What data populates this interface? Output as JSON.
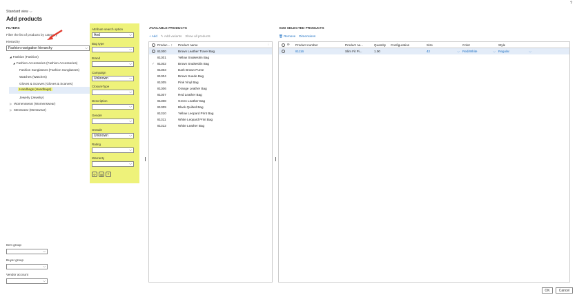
{
  "header": {
    "help_icon": "?",
    "view_name": "Standard view",
    "title": "Add products"
  },
  "filters": {
    "heading": "FILTERS",
    "hint": "Filter the list of products by category",
    "hierarchy_label": "Hierarchy",
    "hierarchy_value": "Fashion navigation hierarchy",
    "tree": [
      {
        "label": "Fashion (Fashion)",
        "toggle": "◢"
      },
      {
        "label": "Fashion Accessories (Fashion Accessories)",
        "toggle": "◢"
      },
      {
        "label": "Fashion Sunglasses (Fashion Sunglasses)",
        "toggle": ""
      },
      {
        "label": "Watches (Watches)",
        "toggle": ""
      },
      {
        "label": "Gloves & Scarves (Gloves & Scarves)",
        "toggle": ""
      },
      {
        "label": "Handbags (Handbags)",
        "toggle": "",
        "selected": true
      },
      {
        "label": "Jewelry (Jewelry)",
        "toggle": ""
      },
      {
        "label": "Womenswear (Womenswear)",
        "toggle": "▷"
      },
      {
        "label": "Menswear (Menswear)",
        "toggle": "▷"
      }
    ],
    "item_group_label": "Item group",
    "buyer_group_label": "Buyer group",
    "vendor_account_label": "Vendor account"
  },
  "attributes": {
    "search_option_label": "Attribute search option",
    "search_option_value": "And",
    "fields": [
      {
        "label": "Bag type",
        "value": ""
      },
      {
        "label": "Brand",
        "value": ""
      },
      {
        "label": "Campaign",
        "value": "Unknown"
      },
      {
        "label": "ClosureType",
        "value": ""
      },
      {
        "label": "Description",
        "value": ""
      },
      {
        "label": "Gender",
        "value": ""
      },
      {
        "label": "OnSale",
        "value": "Unknown"
      },
      {
        "label": "Rating",
        "value": ""
      },
      {
        "label": "Warranty",
        "value": ""
      }
    ]
  },
  "available": {
    "heading": "AVAILABLE PRODUCTS",
    "toolbar": {
      "add": "Add",
      "add_variants": "Add variants",
      "show_all": "Show all products"
    },
    "columns": {
      "product": "Produc...",
      "sort": "↑",
      "name": "Product name"
    },
    "rows": [
      {
        "id": "81300",
        "name": "Brown Leather Travel Bag",
        "selected": true
      },
      {
        "id": "81301",
        "name": "Yellow Snakeskin Bag"
      },
      {
        "id": "81302",
        "name": "Brown Snakeskin Bag",
        "check": true
      },
      {
        "id": "81303",
        "name": "Dark Brown Purse"
      },
      {
        "id": "81304",
        "name": "Brown Suede Bag"
      },
      {
        "id": "81305",
        "name": "Pink Vinyl Bag"
      },
      {
        "id": "81306",
        "name": "Orange Leather Bag"
      },
      {
        "id": "81307",
        "name": "Red Leather Bag"
      },
      {
        "id": "81308",
        "name": "Green Leather Bag"
      },
      {
        "id": "81309",
        "name": "Black Quilted Bag"
      },
      {
        "id": "81310",
        "name": "Yellow Leopard Print Bag"
      },
      {
        "id": "81311",
        "name": "White Leopard Print Bag"
      },
      {
        "id": "81312",
        "name": "White Leather Bag"
      }
    ]
  },
  "selected": {
    "heading": "ADD SELECTED PRODUCTS",
    "toolbar": {
      "remove": "Remove",
      "dimensions": "Dimensions"
    },
    "columns": {
      "number": "Product number",
      "name": "Product na...",
      "quantity": "Quantity",
      "configuration": "Configuration",
      "size": "Size",
      "color": "Color",
      "style": "Style"
    },
    "rows": [
      {
        "number": "81116",
        "name": "Slim Fit Pi...",
        "quantity": "1.00",
        "configuration": "",
        "size": "42",
        "color": "Red/White",
        "style": "Regular"
      }
    ]
  },
  "footer": {
    "ok": "OK",
    "cancel": "Cancel"
  },
  "colors": {
    "highlight": "#eef27a",
    "accent": "#1a6fc4",
    "arrow": "#e23b2e"
  }
}
